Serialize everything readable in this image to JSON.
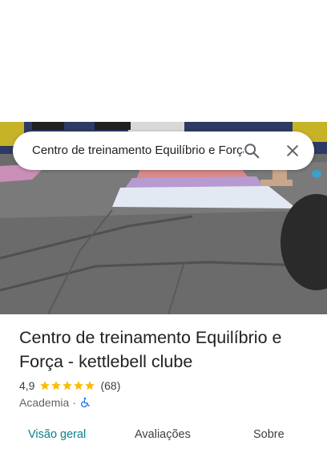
{
  "search": {
    "query": "Centro de treinamento Equilíbrio e Força - kettlebell clube"
  },
  "place": {
    "name": "Centro de treinamento Equilíbrio e Força - kettlebell clube",
    "rating": "4,9",
    "stars": 5,
    "review_count": "(68)",
    "category": "Academia",
    "separator": "·"
  },
  "tabs": [
    {
      "label": "Visão geral",
      "active": true
    },
    {
      "label": "Avaliações",
      "active": false
    },
    {
      "label": "Sobre",
      "active": false
    }
  ],
  "colors": {
    "accent": "#0b7d8a",
    "star": "#fbbc04",
    "accessibility": "#1a73e8"
  },
  "icons": {
    "search": "search-icon",
    "close": "close-icon",
    "accessibility": "wheelchair-accessible-icon"
  }
}
